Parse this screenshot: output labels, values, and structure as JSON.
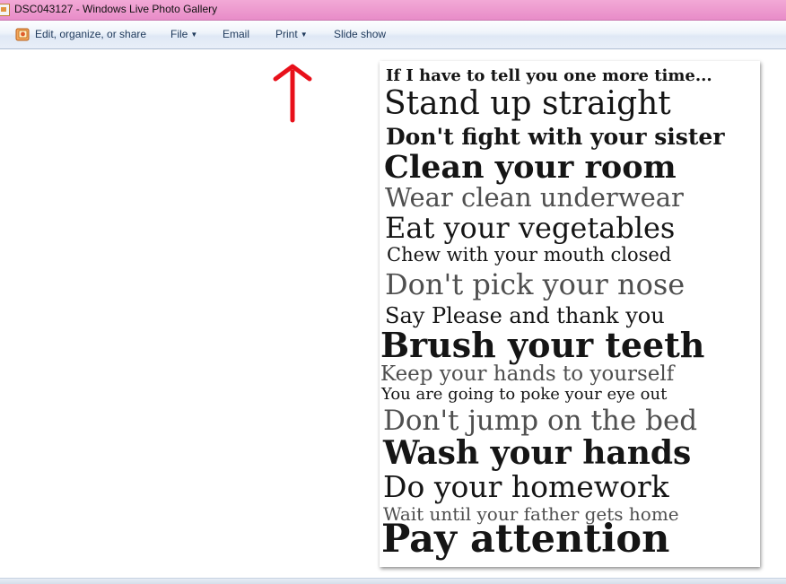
{
  "window": {
    "title": "DSC043127 - Windows Live Photo Gallery"
  },
  "toolbar": {
    "edit_label": "Edit, organize, or share",
    "file_label": "File",
    "email_label": "Email",
    "print_label": "Print",
    "slideshow_label": "Slide show",
    "colors": {
      "text": "#1e395b",
      "titlebar": "#e88cc8",
      "annotation_arrow": "#e8101a"
    }
  },
  "photo": {
    "lines": [
      "If I have to tell you one more time...",
      "Stand up straight",
      "Don't fight with your sister",
      "Clean your room",
      "Wear clean underwear",
      "Eat your vegetables",
      "Chew with your mouth closed",
      "Don't pick your nose",
      "Say Please and thank you",
      "Brush your teeth",
      "Keep your hands to yourself",
      "You are going to poke your eye out",
      "Don't jump on the bed",
      "Wash your hands",
      "Do your homework",
      "Wait until your father gets home",
      "Pay attention"
    ]
  }
}
